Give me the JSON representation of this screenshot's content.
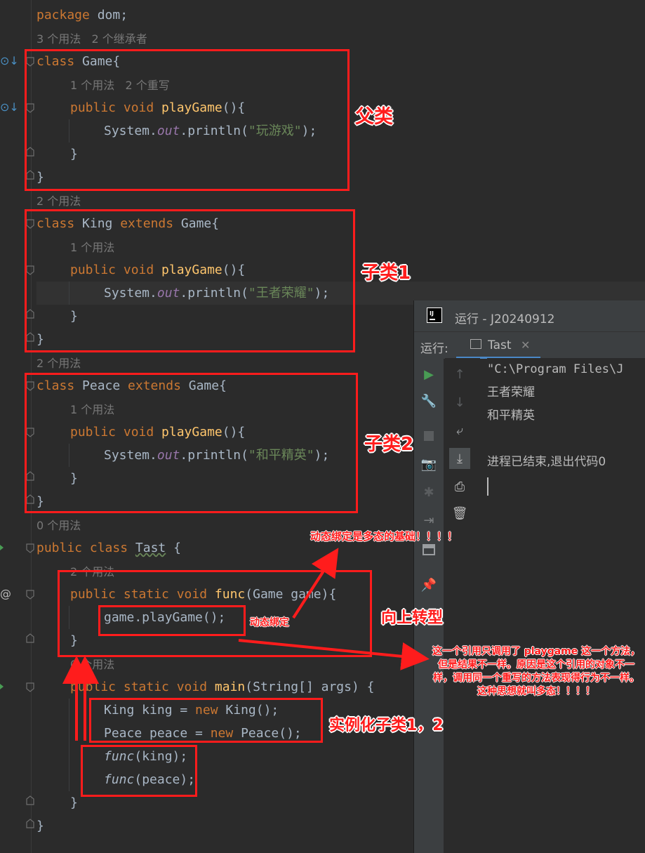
{
  "editor": {
    "line_package": [
      "package",
      " dom;"
    ],
    "hint_1": "3 个用法   2 个继承者",
    "game_class": {
      "kw": "class",
      "name": " Game{"
    },
    "hint_2": "1 个用法   2 个重写",
    "game_method": {
      "kw": "public void ",
      "fn": "playGame",
      "rest": "(){"
    },
    "game_print": {
      "a": "System.",
      "out": "out",
      "b": ".println(",
      "str": "\"玩游戏\"",
      "c": ");"
    },
    "brace_close_inner": "}",
    "brace_close_outer": "}",
    "hint_3": "2 个用法",
    "king_class": {
      "kw1": "class",
      "name": " King ",
      "kw2": "extends",
      "rest": " Game{"
    },
    "hint_4": "1 个用法",
    "king_method": {
      "kw": "public void ",
      "fn": "playGame",
      "rest": "(){"
    },
    "king_print": {
      "a": "System.",
      "out": "out",
      "b": ".println(",
      "str": "\"王者荣耀\"",
      "c": ");"
    },
    "hint_5": "2 个用法",
    "peace_class": {
      "kw1": "class",
      "name": " Peace ",
      "kw2": "extends",
      "rest": " Game{"
    },
    "hint_6": "1 个用法",
    "peace_method": {
      "kw": "public void ",
      "fn": "playGame",
      "rest": "(){"
    },
    "peace_print": {
      "a": "System.",
      "out": "out",
      "b": ".println(",
      "str": "\"和平精英\"",
      "c": ");"
    },
    "hint_7": "0 个用法",
    "tast_class": {
      "kw": "public class ",
      "name": "Tast",
      "rest": " {"
    },
    "hint_8": "2 个用法",
    "func_sig": {
      "kw": "public static void ",
      "fn": "func",
      "rest": "(Game game){"
    },
    "func_body": "game.playGame();",
    "hint_9": "0 个用法",
    "main_sig": {
      "kw": "public static void ",
      "fn": "main",
      "rest": "(String[] args) {"
    },
    "main_l1": {
      "a": "King king = ",
      "kw": "new",
      "b": " King();"
    },
    "main_l2": {
      "a": "Peace peace = ",
      "kw": "new",
      "b": " Peace();"
    },
    "main_l3": {
      "fn": "func",
      "b": "(king);"
    },
    "main_l4": {
      "fn": "func",
      "b": "(peace);"
    }
  },
  "annotations": {
    "parent_class": "父类",
    "subclass_1": "子类1",
    "subclass_2": "子类2",
    "dynamic_basis": "动态绑定是多态的基础！！！！",
    "dynamic_binding": "动态绑定",
    "upcasting": "向上转型",
    "instantiate": "实例化子类1，2",
    "explanation": "这一个引用只调用了 playgame 这一个方法，但是结果不一样。原因是这个引用的对象不一样，调用同一个重写的方法表现得行为不一样。这种思想就叫多态！！！！"
  },
  "run_panel": {
    "title": "运行 - J20240912",
    "tab_prefix": "运行:",
    "tab_name": "Tast",
    "console_lines": [
      "\"C:\\Program Files\\J",
      "王者荣耀",
      "和平精英",
      "",
      "进程已结束,退出代码0"
    ]
  },
  "icons": [
    "run-icon",
    "wrench-icon",
    "stop-icon",
    "camera-icon",
    "debug-icon",
    "login-icon",
    "layout-icon",
    "pin-icon",
    "up-arrow-icon",
    "down-arrow-icon",
    "wrap-icon",
    "scroll-end-icon",
    "print-icon",
    "trash-icon",
    "close-icon",
    "tab-icon",
    "intellij-logo-icon"
  ],
  "colors": {
    "keyword": "#cc7832",
    "function": "#ffc66d",
    "string": "#6a8759",
    "field": "#9876aa",
    "annotation_red": "#ff1c1c",
    "run_green": "#499c54"
  }
}
